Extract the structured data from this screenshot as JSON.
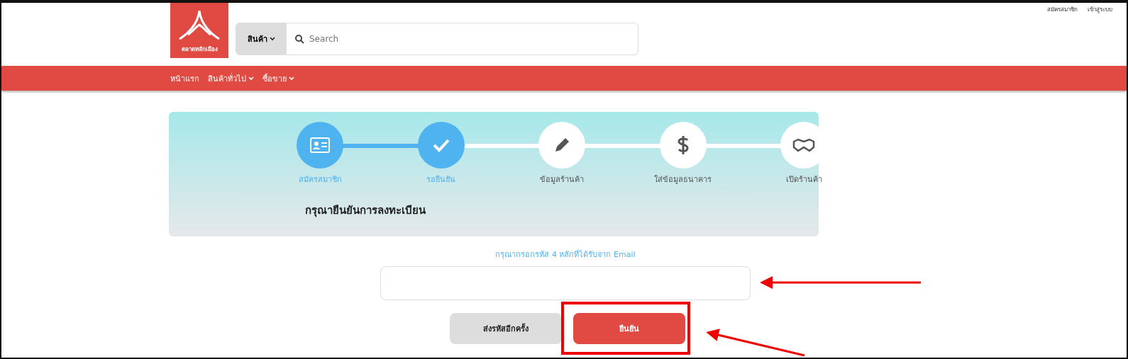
{
  "header": {
    "logo_text": "ตลาดหลักเมือง",
    "search": {
      "category": "สินค้า",
      "placeholder": "Search"
    },
    "top_links": [
      "สมัครสมาชิก",
      "เข้าสู่ระบบ"
    ]
  },
  "nav": [
    {
      "label": "หน้าแรก",
      "dropdown": false
    },
    {
      "label": "สินค้าทั่วไป",
      "dropdown": true
    },
    {
      "label": "ซื้อขาย",
      "dropdown": true
    }
  ],
  "steps": [
    {
      "label": "สมัครสมาชิก",
      "done": true,
      "kind": "card"
    },
    {
      "label": "รอยืนยัน",
      "done": true,
      "kind": "check"
    },
    {
      "label": "ข้อมูลร้านค้า",
      "done": false,
      "kind": "pencil"
    },
    {
      "label": "ใส่ข้อมูลธนาคาร",
      "done": false,
      "kind": "dollar"
    },
    {
      "label": "เปิดร้านค้า",
      "done": false,
      "kind": "handshake"
    }
  ],
  "heading": "กรุณายืนยันการลงทะเบียน",
  "hint": "กรุณากรอกรหัส 4 หลักที่ได้รับจาก Email",
  "buttons": [
    {
      "label": "ส่งรหัสอีกครั้ง",
      "kind": "secondary"
    },
    {
      "label": "ยืนยัน",
      "kind": "primary"
    }
  ]
}
